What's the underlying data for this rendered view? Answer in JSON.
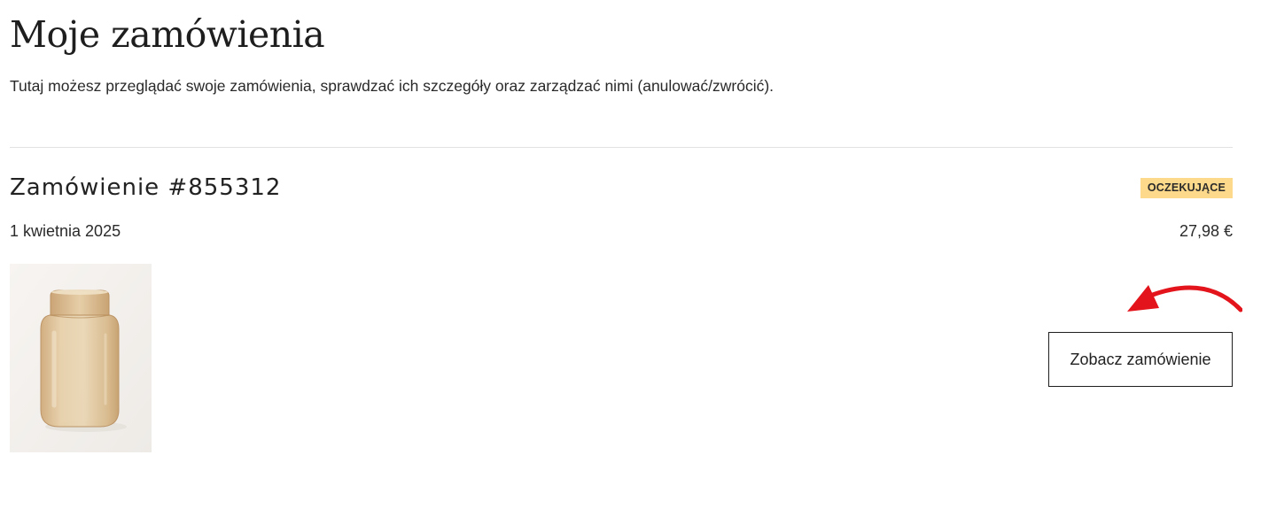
{
  "header": {
    "title": "Moje zamówienia",
    "subtitle": "Tutaj możesz przeglądać swoje zamówienia, sprawdzać ich szczegóły oraz zarządzać nimi (anulować/zwrócić)."
  },
  "orders": [
    {
      "title": "Zamówienie #855312",
      "status": "OCZEKUJĄCE",
      "date": "1 kwietnia 2025",
      "total": "27,98 €",
      "product_image": "amber-glass-vase",
      "view_button_label": "Zobacz zamówienie"
    }
  ],
  "colors": {
    "status_badge": "#fdd98b",
    "annotation_arrow": "#e3141b",
    "button_border": "#1e1e1e",
    "divider": "#e2e2e2"
  },
  "annotation": {
    "icon": "red-curved-arrow-icon"
  }
}
